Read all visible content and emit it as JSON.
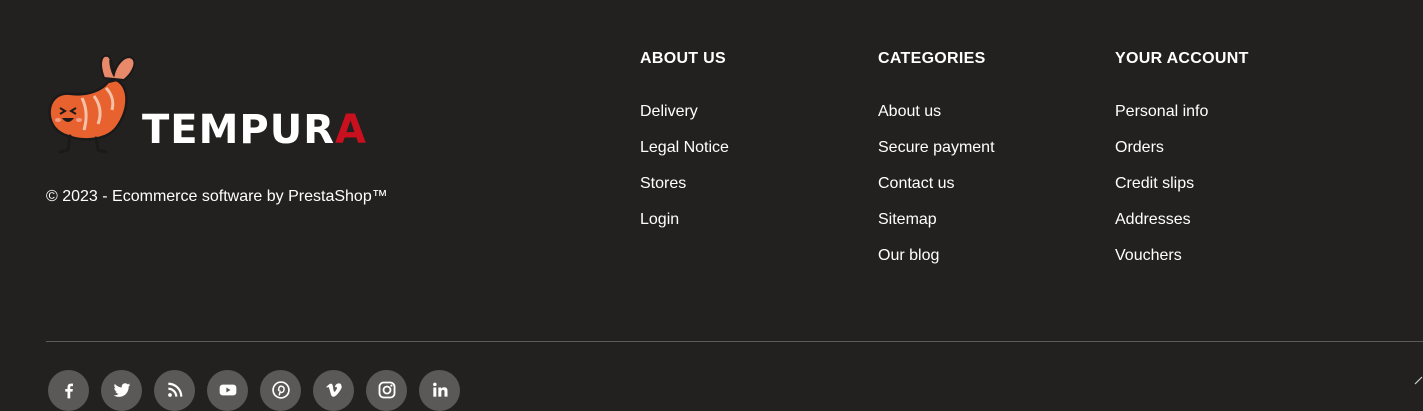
{
  "brand": {
    "logo_word_main": "TEMPUR",
    "logo_word_accent": "A",
    "copyright": "© 2023 - Ecommerce software by PrestaShop™",
    "accent_color": "#c8101e"
  },
  "columns": [
    {
      "title": "ABOUT US",
      "links": [
        "Delivery",
        "Legal Notice",
        "Stores",
        "Login"
      ]
    },
    {
      "title": "CATEGORIES",
      "links": [
        "About us",
        "Secure payment",
        "Contact us",
        "Sitemap",
        "Our blog"
      ]
    },
    {
      "title": "YOUR ACCOUNT",
      "links": [
        "Personal info",
        "Orders",
        "Credit slips",
        "Addresses",
        "Vouchers"
      ]
    }
  ],
  "socials": [
    "facebook-icon",
    "twitter-icon",
    "rss-icon",
    "youtube-icon",
    "pinterest-icon",
    "vimeo-icon",
    "instagram-icon",
    "linkedin-icon"
  ],
  "colors": {
    "background": "#22211f",
    "social_bg": "#5a5957",
    "divider": "#5c5a57"
  }
}
